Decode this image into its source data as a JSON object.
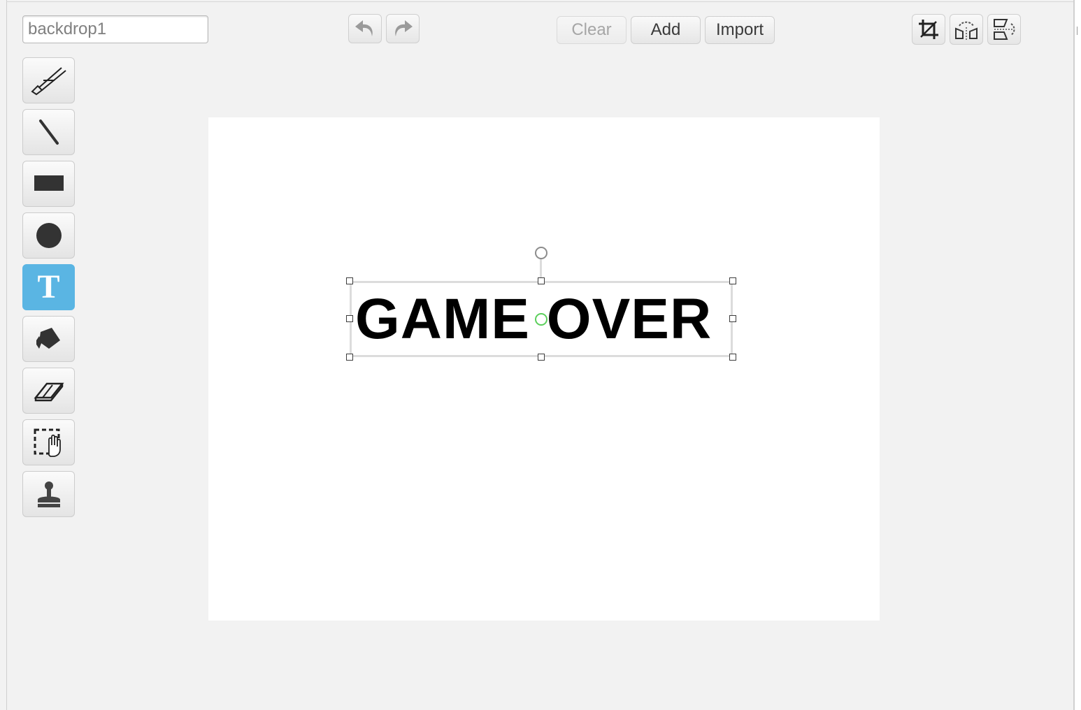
{
  "costume_name": {
    "value": "backdrop1"
  },
  "history": {
    "undo_icon": "undo-icon",
    "redo_icon": "redo-icon"
  },
  "actions": {
    "clear_label": "Clear",
    "add_label": "Add",
    "import_label": "Import"
  },
  "transform_tools": [
    {
      "icon": "set-costume-center-icon"
    },
    {
      "icon": "flip-horizontal-icon"
    },
    {
      "icon": "flip-vertical-icon"
    }
  ],
  "tools": [
    {
      "icon": "brush-icon",
      "active": false
    },
    {
      "icon": "line-icon",
      "active": false
    },
    {
      "icon": "rectangle-icon",
      "active": false
    },
    {
      "icon": "ellipse-icon",
      "active": false
    },
    {
      "icon": "text-icon",
      "label": "T",
      "active": true
    },
    {
      "icon": "fill-bucket-icon",
      "active": false
    },
    {
      "icon": "eraser-icon",
      "active": false
    },
    {
      "icon": "select-icon",
      "active": false
    },
    {
      "icon": "stamp-icon",
      "active": false
    }
  ],
  "canvas": {
    "text": "GAME OVER",
    "text_color": "#000000",
    "selection_center_color": "#5ccf5c"
  },
  "colors": {
    "active_tool": "#5ab5e3",
    "background": "#f2f2f2",
    "canvas": "#ffffff"
  }
}
